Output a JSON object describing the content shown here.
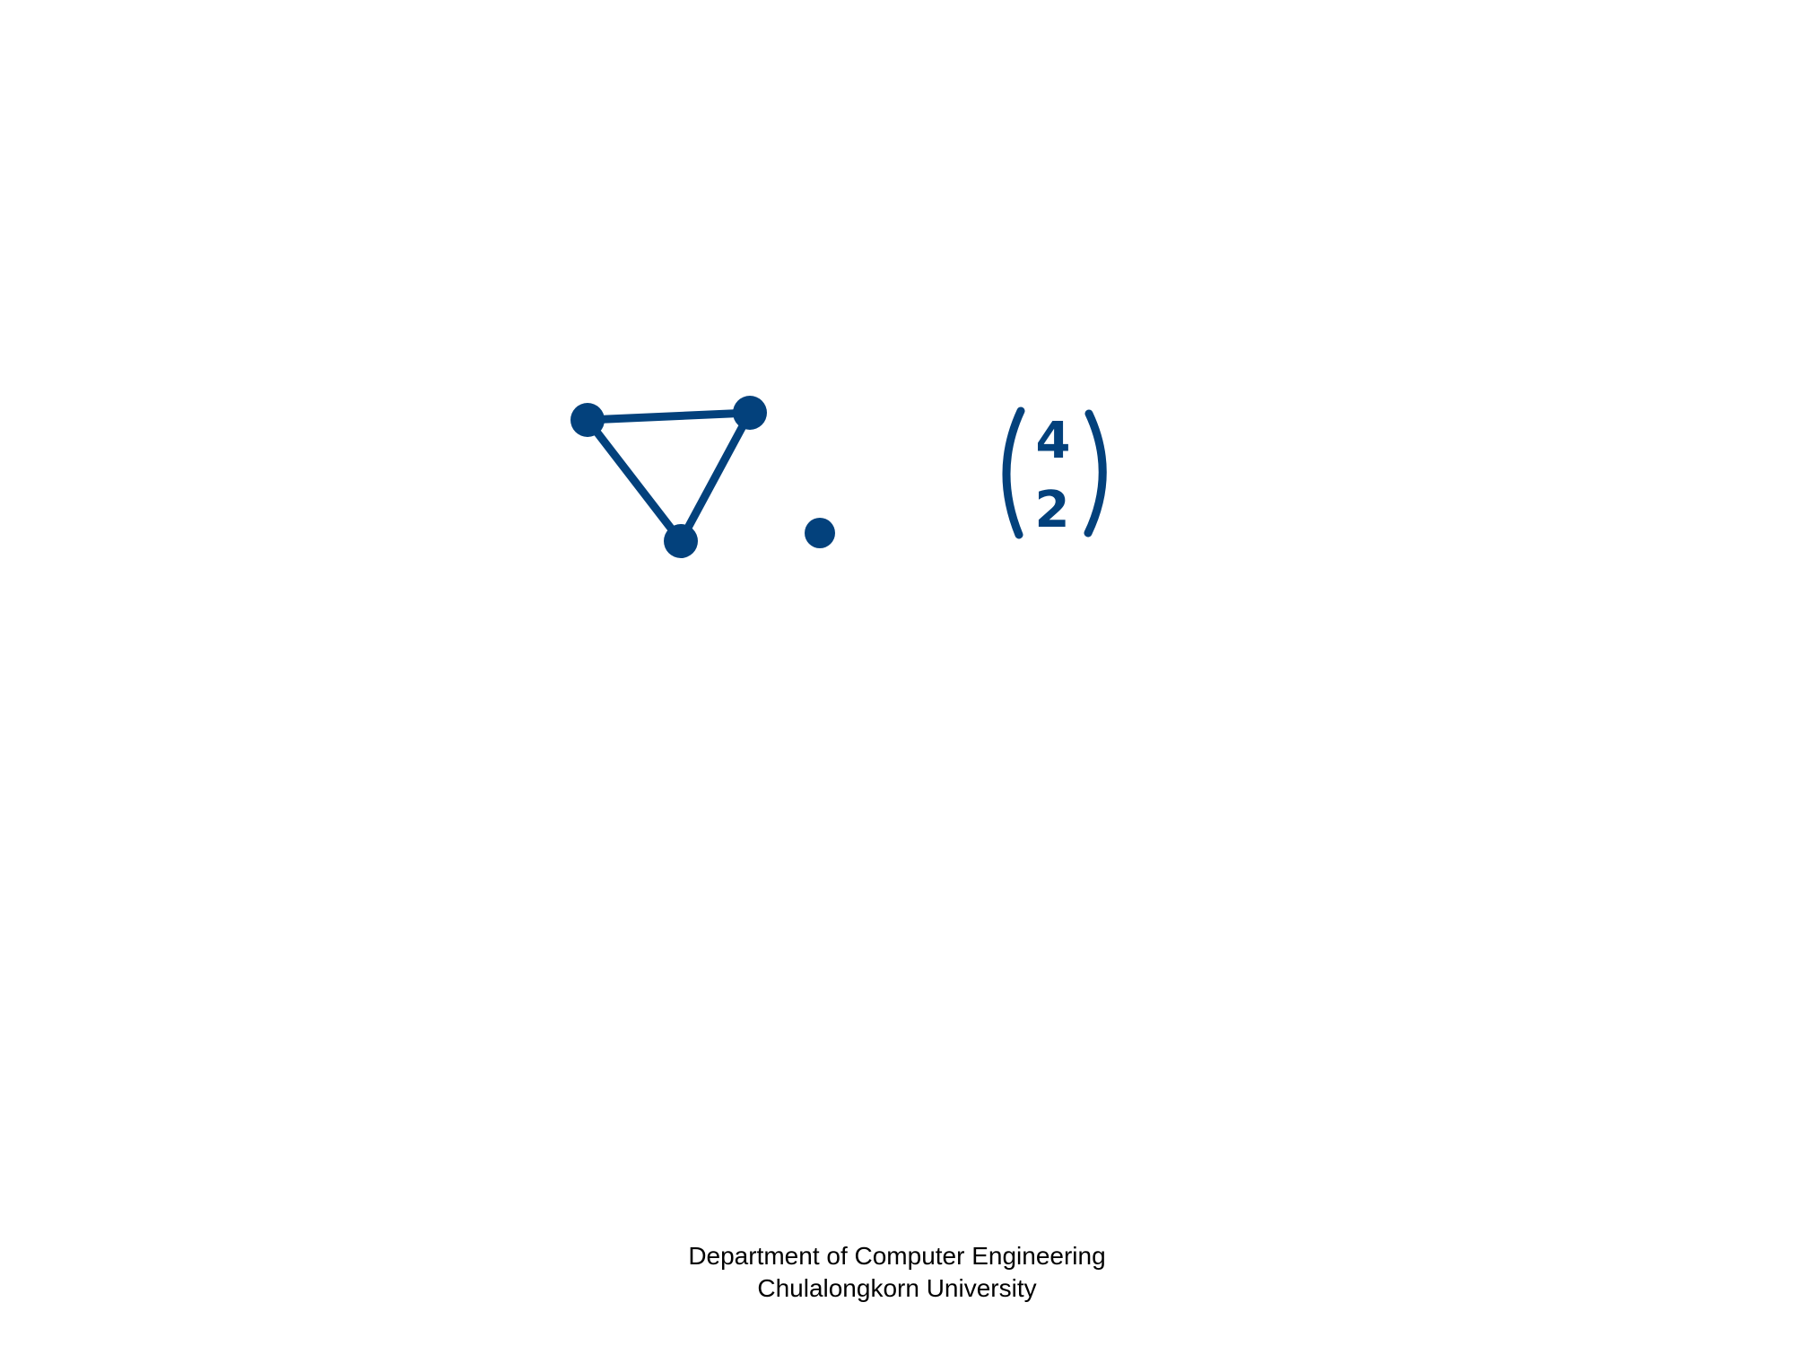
{
  "diagram": {
    "color": "#03417c",
    "graph": {
      "nodes": [
        "a",
        "b",
        "c",
        "d"
      ],
      "edges": [
        [
          "a",
          "b"
        ],
        [
          "b",
          "c"
        ],
        [
          "c",
          "a"
        ]
      ]
    },
    "binomial": {
      "top": "4",
      "bottom": "2"
    }
  },
  "footer": {
    "line1": "Department of Computer Engineering",
    "line2": "Chulalongkorn University"
  }
}
